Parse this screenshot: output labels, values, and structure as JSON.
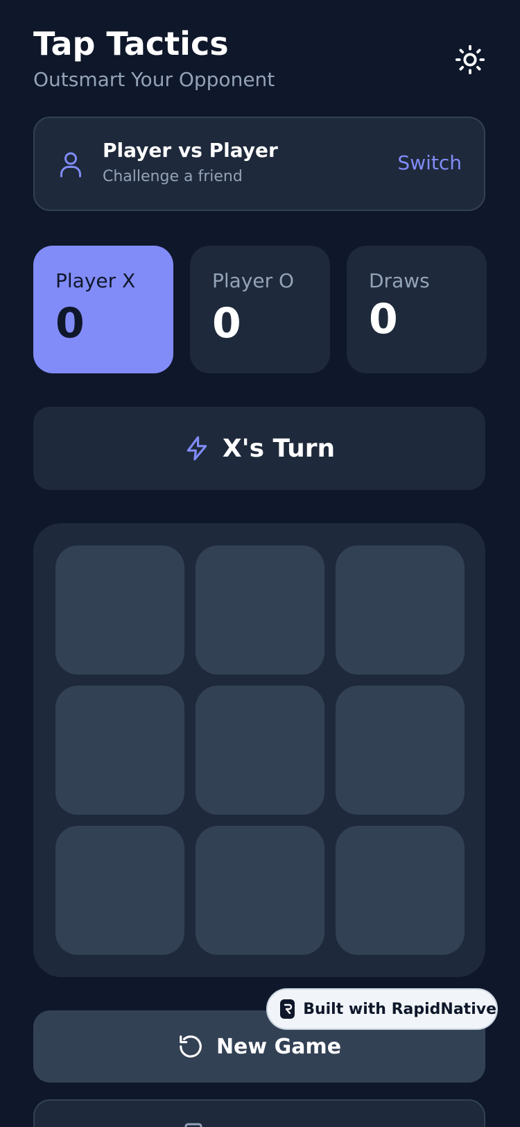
{
  "header": {
    "title": "Tap Tactics",
    "subtitle": "Outsmart Your Opponent",
    "theme_icon": "sun-icon"
  },
  "mode": {
    "icon": "user-icon",
    "title": "Player vs Player",
    "description": "Challenge a friend",
    "switch_label": "Switch"
  },
  "scores": [
    {
      "label": "Player X",
      "value": "0",
      "active": true
    },
    {
      "label": "Player O",
      "value": "0",
      "active": false
    },
    {
      "label": "Draws",
      "value": "0",
      "active": false
    }
  ],
  "turn": {
    "icon": "lightning-icon",
    "text": "X's Turn"
  },
  "board": {
    "cells": [
      "",
      "",
      "",
      "",
      "",
      "",
      "",
      "",
      ""
    ]
  },
  "actions": {
    "new_game_label": "New Game",
    "new_game_icon": "restart-icon"
  },
  "badge": {
    "label": "Built with RapidNative"
  },
  "colors": {
    "background": "#0f172a",
    "surface": "#1e293b",
    "cell": "#334155",
    "accent": "#818cf8",
    "muted": "#94a3b8"
  }
}
